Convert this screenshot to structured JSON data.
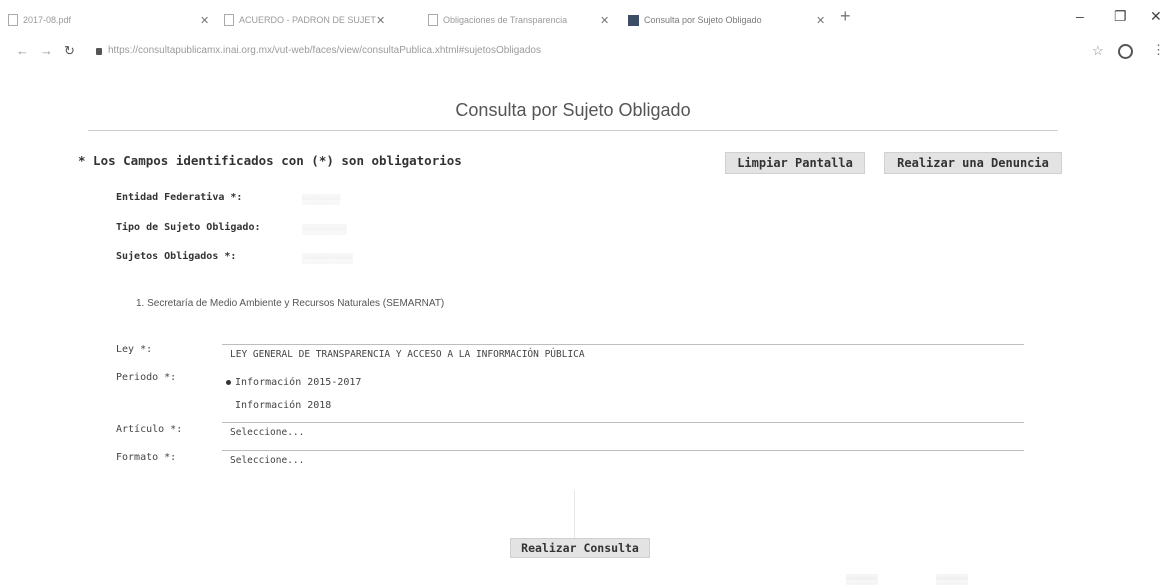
{
  "browser": {
    "tabs": [
      {
        "label": "2017-08.pdf"
      },
      {
        "label": "ACUERDO - PADRON DE SUJET"
      },
      {
        "label": "Obligaciones de Transparencia"
      },
      {
        "label": "Consulta por Sujeto Obligado"
      }
    ],
    "new_tab": "+",
    "url": "https://consultapublicamx.inai.org.mx/vut-web/faces/view/consultaPublica.xhtml#sujetosObligados"
  },
  "page": {
    "title": "Consulta por Sujeto Obligado",
    "required_note": "* Los Campos identificados con (*) son obligatorios",
    "buttons": {
      "clear": "Limpiar Pantalla",
      "denuncia": "Realizar una Denuncia",
      "consulta": "Realizar Consulta"
    },
    "filters": {
      "entidad_label": "Entidad Federativa *:",
      "tipo_label": "Tipo de Sujeto Obligado:",
      "sujetos_label": "Sujetos Obligados *:"
    },
    "result_item": "1. Secretaría de Medio Ambiente y Recursos Naturales (SEMARNAT)",
    "form": {
      "ley_label": "Ley *:",
      "ley_value": "LEY GENERAL DE TRANSPARENCIA Y ACCESO A LA INFORMACIÓN PÚBLICA",
      "periodo_label": "Periodo *:",
      "periodo_options": [
        "Información 2015-2017",
        "Información 2018"
      ],
      "articulo_label": "Artículo *:",
      "articulo_value": "Seleccione...",
      "formato_label": "Formato *:",
      "formato_value": "Seleccione..."
    }
  }
}
